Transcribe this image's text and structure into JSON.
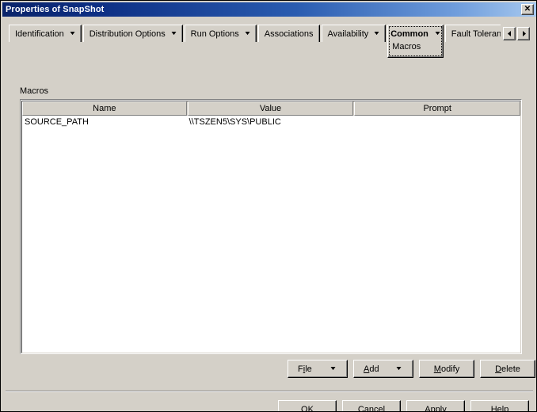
{
  "window": {
    "title": "Properties of SnapShot",
    "close_label": "✕",
    "close_icon": "close-icon"
  },
  "tabs": [
    {
      "label": "Identification",
      "has_dropdown": true,
      "active": false
    },
    {
      "label": "Distribution Options",
      "has_dropdown": true,
      "active": false
    },
    {
      "label": "Run Options",
      "has_dropdown": true,
      "active": false
    },
    {
      "label": "Associations",
      "has_dropdown": false,
      "active": false
    },
    {
      "label": "Availability",
      "has_dropdown": true,
      "active": false
    },
    {
      "label": "Common",
      "has_dropdown": true,
      "active": true,
      "subitem": "Macros"
    },
    {
      "label": "Fault Tolerance",
      "has_dropdown": false,
      "active": false,
      "clipped": true
    }
  ],
  "tab_scroll": {
    "prev_label": "◄",
    "next_label": "►",
    "prev_icon": "scroll-left-icon",
    "next_icon": "scroll-right-icon"
  },
  "group": {
    "label": "Macros"
  },
  "table": {
    "columns": [
      "Name",
      "Value",
      "Prompt"
    ],
    "rows": [
      {
        "name": "SOURCE_PATH",
        "value": "\\\\TSZEN5\\SYS\\PUBLIC",
        "prompt": ""
      }
    ]
  },
  "actions": {
    "file": {
      "pre": "F",
      "acc": "i",
      "post": "le",
      "arrow": "▼"
    },
    "add": {
      "pre": "",
      "acc": "A",
      "post": "dd",
      "arrow": "▼"
    },
    "modify": {
      "pre": "",
      "acc": "M",
      "post": "odify"
    },
    "delete": {
      "pre": "",
      "acc": "D",
      "post": "elete"
    }
  },
  "dialog_buttons": [
    {
      "label": "OK"
    },
    {
      "label": "Cancel"
    },
    {
      "label": "Apply"
    },
    {
      "label": "Help"
    }
  ],
  "colors": {
    "face": "#d4d0c8",
    "title_start": "#0a246a",
    "title_end": "#a6c8ee",
    "window_bg": "#ffffff",
    "text": "#000000"
  }
}
